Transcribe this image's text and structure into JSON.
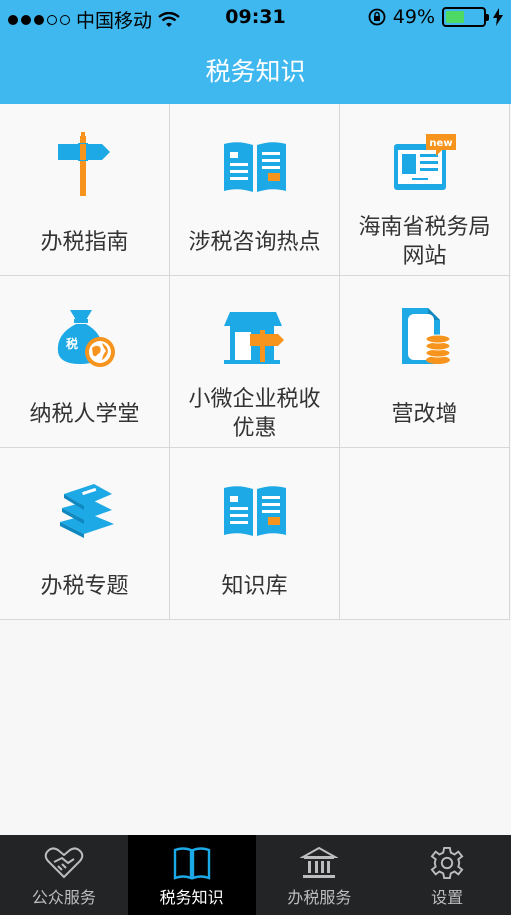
{
  "status_bar": {
    "carrier": "中国移动",
    "time": "09:31",
    "battery": "49%",
    "battery_level": 0.49
  },
  "nav": {
    "title": "税务知识"
  },
  "grid_items": [
    {
      "label": "办税指南",
      "icon": "signpost-icon"
    },
    {
      "label": "涉税咨询热点",
      "icon": "open-book-icon"
    },
    {
      "label": "海南省税务局网站",
      "icon": "new-website-icon"
    },
    {
      "label": "纳税人学堂",
      "icon": "tax-bag-globe-icon"
    },
    {
      "label": "小微企业税收优惠",
      "icon": "shop-sign-icon"
    },
    {
      "label": "营改增",
      "icon": "document-coins-icon"
    },
    {
      "label": "办税专题",
      "icon": "book-stack-icon"
    },
    {
      "label": "知识库",
      "icon": "open-book-icon"
    }
  ],
  "tabs": [
    {
      "label": "公众服务",
      "icon": "heart-handshake-icon"
    },
    {
      "label": "税务知识",
      "icon": "book-icon"
    },
    {
      "label": "办税服务",
      "icon": "bank-building-icon"
    },
    {
      "label": "设置",
      "icon": "gear-icon"
    }
  ],
  "colors": {
    "header": "#3eb8ef",
    "icon_blue": "#1da9e6",
    "icon_orange": "#f7941d",
    "tab_bar": "#222426"
  }
}
